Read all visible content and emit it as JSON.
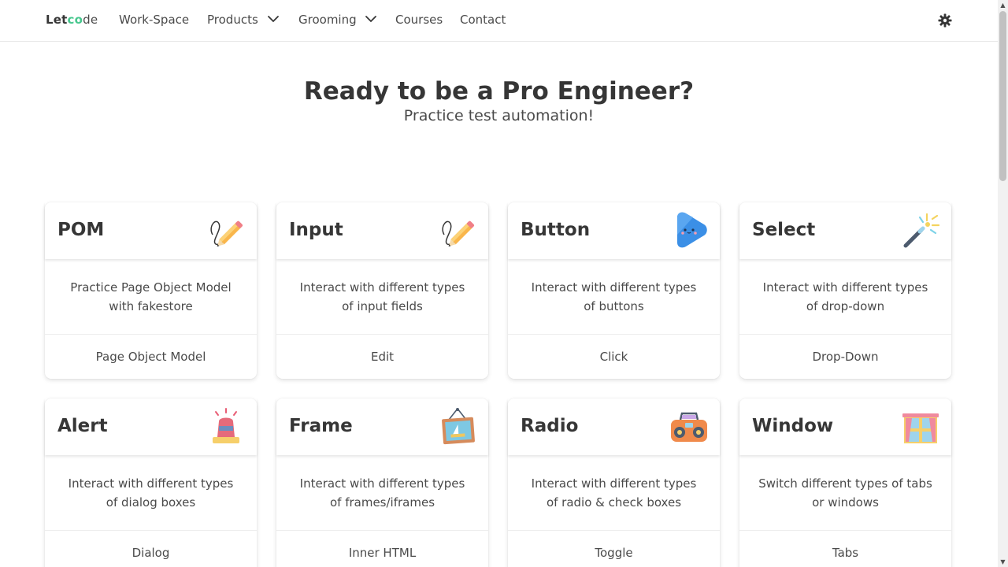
{
  "nav": {
    "logo": {
      "prefix": "Let",
      "accent": "co",
      "suffix": "de"
    },
    "items": [
      {
        "label": "Work-Space"
      },
      {
        "label": "Products"
      },
      {
        "label": "Grooming"
      },
      {
        "label": "Courses"
      },
      {
        "label": "Contact"
      }
    ],
    "theme_icon": "gear-icon"
  },
  "hero": {
    "title": "Ready to be a Pro Engineer?",
    "subtitle": "Practice test automation!"
  },
  "cards": [
    {
      "title": "POM",
      "description": "Practice Page Object Model with fakestore",
      "action": "Page Object Model",
      "icon": "pencil-icon"
    },
    {
      "title": "Input",
      "description": "Interact with different types of input fields",
      "action": "Edit",
      "icon": "pencil-icon"
    },
    {
      "title": "Button",
      "description": "Interact with different types of buttons",
      "action": "Click",
      "icon": "play-button-icon"
    },
    {
      "title": "Select",
      "description": "Interact with different types of drop-down",
      "action": "Drop-Down",
      "icon": "magic-wand-icon"
    },
    {
      "title": "Alert",
      "description": "Interact with different types of dialog boxes",
      "action": "Dialog",
      "icon": "siren-icon"
    },
    {
      "title": "Frame",
      "description": "Interact with different types of frames/iframes",
      "action": "Inner HTML",
      "icon": "picture-frame-icon"
    },
    {
      "title": "Radio",
      "description": "Interact with different types of radio & check boxes",
      "action": "Toggle",
      "icon": "radio-icon"
    },
    {
      "title": "Window",
      "description": "Switch different types of tabs or windows",
      "action": "Tabs",
      "icon": "window-icon"
    }
  ]
}
